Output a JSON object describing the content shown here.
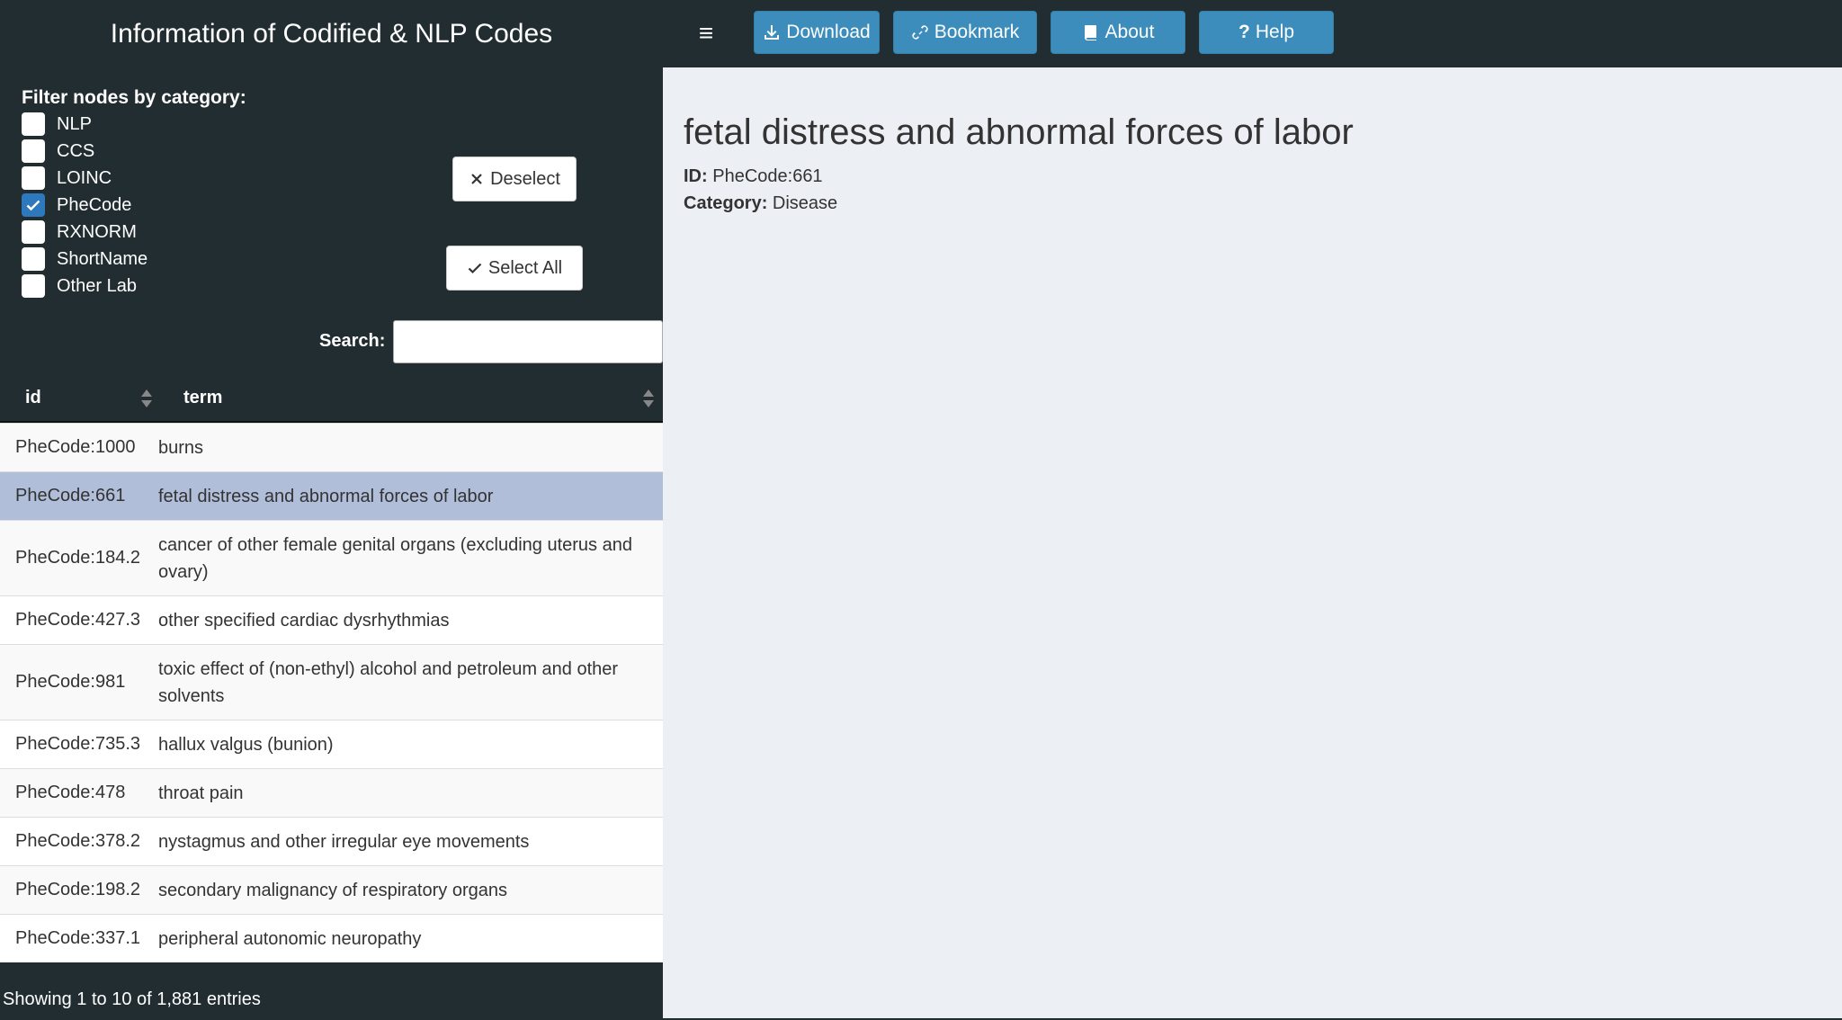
{
  "header": {
    "title": "Information of Codified & NLP Codes",
    "buttons": {
      "download": "Download",
      "bookmark": "Bookmark",
      "about": "About",
      "help": "Help"
    }
  },
  "sidebar": {
    "filter_title": "Filter nodes by category:",
    "categories": [
      {
        "label": "NLP",
        "checked": false
      },
      {
        "label": "CCS",
        "checked": false
      },
      {
        "label": "LOINC",
        "checked": false
      },
      {
        "label": "PheCode",
        "checked": true
      },
      {
        "label": "RXNORM",
        "checked": false
      },
      {
        "label": "ShortName",
        "checked": false
      },
      {
        "label": "Other Lab",
        "checked": false
      }
    ],
    "deselect_label": "Deselect",
    "select_all_label": "Select All",
    "search_label": "Search:",
    "search_value": ""
  },
  "table": {
    "columns": [
      "id",
      "term"
    ],
    "rows": [
      {
        "id": "PheCode:1000",
        "term": "burns"
      },
      {
        "id": "PheCode:661",
        "term": "fetal distress and abnormal forces of labor"
      },
      {
        "id": "PheCode:184.2",
        "term": "cancer of other female genital organs (excluding uterus and ovary)"
      },
      {
        "id": "PheCode:427.3",
        "term": "other specified cardiac dysrhythmias"
      },
      {
        "id": "PheCode:981",
        "term": "toxic effect of (non-ethyl) alcohol and petroleum and other solvents"
      },
      {
        "id": "PheCode:735.3",
        "term": "hallux valgus (bunion)"
      },
      {
        "id": "PheCode:478",
        "term": "throat pain"
      },
      {
        "id": "PheCode:378.2",
        "term": "nystagmus and other irregular eye movements"
      },
      {
        "id": "PheCode:198.2",
        "term": "secondary malignancy of respiratory organs"
      },
      {
        "id": "PheCode:337.1",
        "term": "peripheral autonomic neuropathy"
      }
    ],
    "selected_row": 1,
    "info": "Showing 1 to 10 of 1,881 entries"
  },
  "detail": {
    "title": "fetal distress and abnormal forces of labor",
    "id_label": "ID:",
    "id_value": "PheCode:661",
    "category_label": "Category:",
    "category_value": "Disease"
  },
  "colors": {
    "sidebar_bg": "#222d32",
    "button_blue": "#3c8dbc",
    "selected_row": "#b0bed9",
    "main_bg": "#ecf0f5"
  }
}
